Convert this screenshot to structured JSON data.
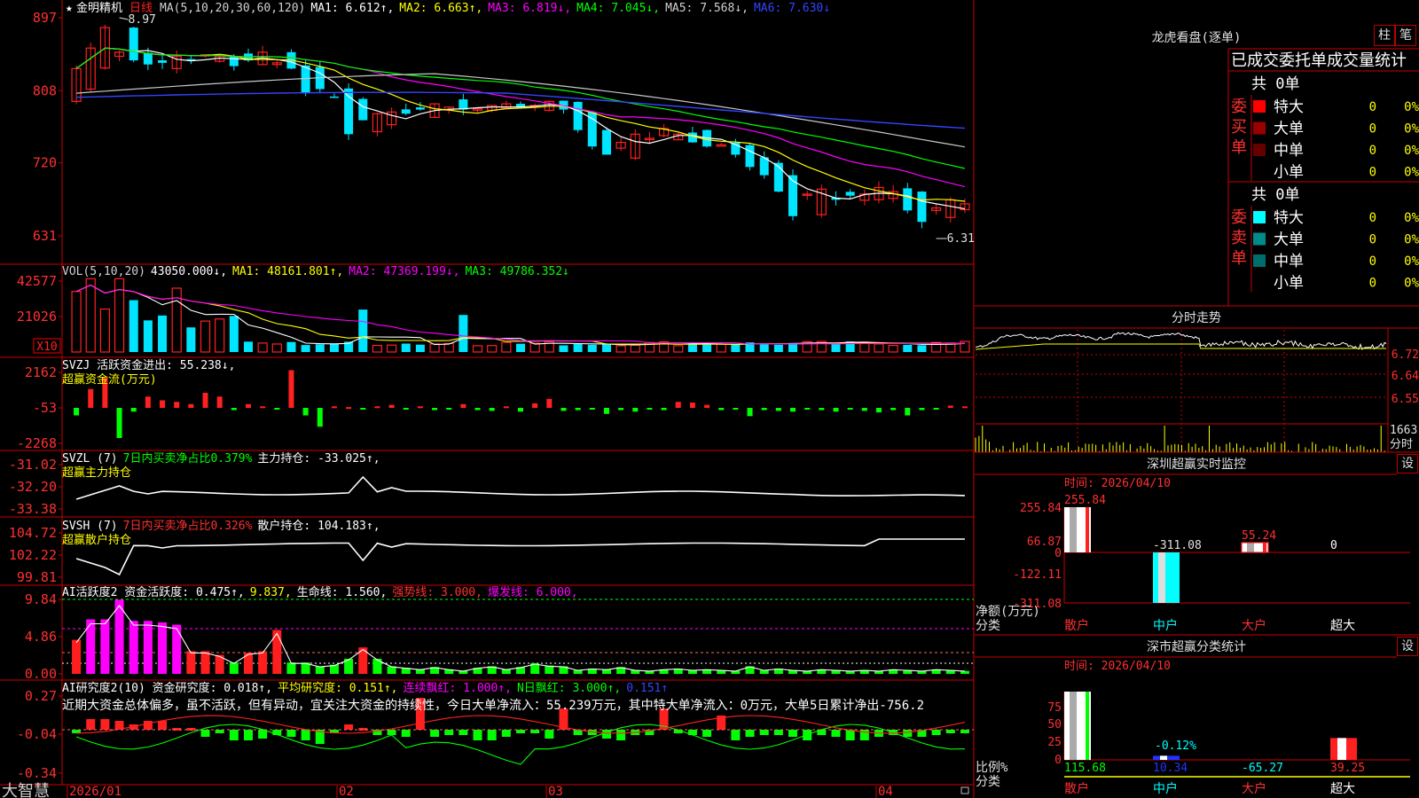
{
  "colors": {
    "bg": "#000000",
    "grid": "#cc0000",
    "up": "#ff2020",
    "down": "#00e5ff",
    "white": "#ffffff",
    "yellow": "#ffff00",
    "magenta": "#ff00ff",
    "green": "#00ff00",
    "blue": "#3344ff",
    "label": "#ff3030"
  },
  "header": {
    "star": "★",
    "name": "金明精机",
    "period": "日线",
    "ma_items": [
      {
        "text": "MA(5,10,20,30,60,120)",
        "color": "#d0d0d0"
      },
      {
        "text": "MA1: 6.612↑,",
        "color": "#ffffff"
      },
      {
        "text": "MA2: 6.663↑,",
        "color": "#ffff00"
      },
      {
        "text": "MA3: 6.819↓,",
        "color": "#ff00ff"
      },
      {
        "text": "MA4: 7.045↓,",
        "color": "#00ff00"
      },
      {
        "text": "MA5: 7.568↓,",
        "color": "#d0d0d0"
      },
      {
        "text": "MA6: 7.630↓",
        "color": "#3344ff"
      }
    ]
  },
  "main_chart": {
    "y_ticks": [
      "897",
      "808",
      "720",
      "631"
    ],
    "hi_label": "8.97",
    "lo_label": "6.31",
    "date_labels": [
      "2026/01",
      "02",
      "03",
      "04"
    ]
  },
  "vol_panel": {
    "title_items": [
      {
        "text": "VOL(5,10,20)",
        "color": "#d0d0d0"
      },
      {
        "text": "43050.000↓,",
        "color": "#ffffff"
      },
      {
        "text": "MA1: 48161.801↑,",
        "color": "#ffff00"
      },
      {
        "text": "MA2: 47369.199↓,",
        "color": "#ff00ff"
      },
      {
        "text": "MA3: 49786.352↓",
        "color": "#00ff00"
      }
    ],
    "y_ticks": [
      "42577",
      "21026"
    ],
    "unit": "X10"
  },
  "svzj_panel": {
    "title_items": [
      {
        "text": "SVZJ  活跃资金进出: 55.238↓,",
        "color": "#ffffff"
      }
    ],
    "subtitle": "超赢资金流(万元)",
    "y_ticks": [
      "2162",
      "-53",
      "-2268"
    ]
  },
  "svzl_panel": {
    "title_items": [
      {
        "text": "SVZL (7)",
        "color": "#ffffff"
      },
      {
        "text": "7日内买卖净占比0.379%",
        "color": "#00ff00"
      },
      {
        "text": "主力持仓: -33.025↑,",
        "color": "#ffffff"
      }
    ],
    "subtitle": "超赢主力持仓",
    "y_ticks": [
      "-31.02",
      "-32.20",
      "-33.38"
    ]
  },
  "svsh_panel": {
    "title_items": [
      {
        "text": "SVSH (7)",
        "color": "#ffffff"
      },
      {
        "text": "7日内买卖净占比0.326%",
        "color": "#ff3030"
      },
      {
        "text": "散户持仓: 104.183↑,",
        "color": "#ffffff"
      }
    ],
    "subtitle": "超赢散户持仓",
    "y_ticks": [
      "104.72",
      "102.22",
      "99.81"
    ]
  },
  "ai_activity_panel": {
    "title_items": [
      {
        "text": "AI活跃度2 资金活跃度: 0.475↑,",
        "color": "#ffffff"
      },
      {
        "text": "9.837,",
        "color": "#ffff00"
      },
      {
        "text": "生命线: 1.560,",
        "color": "#ffffff"
      },
      {
        "text": "强势线: 3.000,",
        "color": "#ff3030"
      },
      {
        "text": "爆发线: 6.000,",
        "color": "#ff00ff"
      }
    ],
    "y_ticks": [
      "9.84",
      "4.86",
      "0.00"
    ]
  },
  "ai_research_panel": {
    "title_items": [
      {
        "text": "AI研究度2(10) 资金研究度: 0.018↑,",
        "color": "#ffffff"
      },
      {
        "text": "平均研究度: 0.151↑,",
        "color": "#ffff00"
      },
      {
        "text": "连续飘红: 1.000↑,",
        "color": "#ff00ff"
      },
      {
        "text": "N日飘红: 3.000↑,",
        "color": "#00ff00"
      },
      {
        "text": "0.151↑",
        "color": "#3344ff"
      }
    ],
    "comment": "近期大资金总体偏多，虽不活跃，但有异动，宜关注大资金的持续性，今日大单净流入：55.239万元，其中特大单净流入：0万元，大单5日累计净出-756.2",
    "y_ticks": [
      "0.27",
      "-0.04",
      "-0.34"
    ]
  },
  "brand": "大智慧",
  "dragon_tiger": {
    "title": "龙虎看盘(逐单)",
    "btn_zhu": "柱",
    "btn_bi": "笔",
    "tabs": [
      "已成交",
      "委托单",
      "成交量统计"
    ],
    "buy": {
      "label": "委买单",
      "total": "共 0单",
      "rows": [
        {
          "name": "特大",
          "val": "0",
          "pct": "0%",
          "color": "#ff0000"
        },
        {
          "name": "大单",
          "val": "0",
          "pct": "0%",
          "color": "#990000"
        },
        {
          "name": "中单",
          "val": "0",
          "pct": "0%",
          "color": "#660000"
        },
        {
          "name": "小单",
          "val": "0",
          "pct": "0%",
          "color": ""
        }
      ]
    },
    "sell": {
      "label": "委卖单",
      "total": "共 0单",
      "rows": [
        {
          "name": "特大",
          "val": "0",
          "pct": "0%",
          "color": "#00ffff"
        },
        {
          "name": "大单",
          "val": "0",
          "pct": "0%",
          "color": "#008b8b"
        },
        {
          "name": "中单",
          "val": "0",
          "pct": "0%",
          "color": "#006d6d"
        },
        {
          "name": "小单",
          "val": "0",
          "pct": "0%",
          "color": ""
        }
      ]
    }
  },
  "intraday": {
    "title": "分时走势",
    "y_ticks": [
      "6.72",
      "6.64",
      "6.55"
    ],
    "vol_tick": "1663",
    "vol_label": "分时"
  },
  "sz_monitor": {
    "title": "深圳超赢实时监控",
    "btn": "设",
    "time": "时间: 2026/04/10",
    "y_ticks": [
      "255.84",
      "66.87",
      "0",
      "-122.11",
      "-311.08"
    ],
    "bar_labels": [
      "255.84",
      "-311.08",
      "55.24",
      "0"
    ],
    "categories": [
      "散户",
      "中户",
      "大户",
      "超大"
    ],
    "ylabel_1": "净额(万元)",
    "ylabel_2": "分类",
    "values": [
      255.84,
      -311.08,
      55.24,
      0
    ]
  },
  "sz_classify": {
    "title": "深市超赢分类统计",
    "btn": "设",
    "time": "时间: 2026/04/10",
    "y_ticks": [
      "75",
      "50",
      "25",
      "0"
    ],
    "inner_label": "-0.12%",
    "bottom_values": [
      "115.68",
      "10.34",
      "-65.27",
      "39.25"
    ],
    "categories": [
      "散户",
      "中户",
      "大户",
      "超大"
    ],
    "ylabel_1": "比例%",
    "ylabel_2": "分类",
    "values": [
      100,
      6,
      0,
      32
    ]
  }
}
